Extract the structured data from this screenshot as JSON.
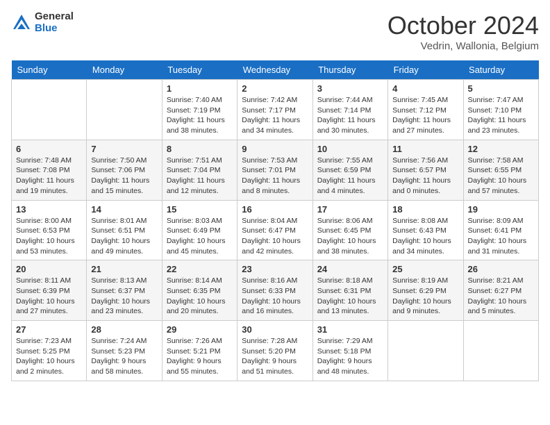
{
  "logo": {
    "general": "General",
    "blue": "Blue"
  },
  "title": "October 2024",
  "location": "Vedrin, Wallonia, Belgium",
  "days_of_week": [
    "Sunday",
    "Monday",
    "Tuesday",
    "Wednesday",
    "Thursday",
    "Friday",
    "Saturday"
  ],
  "weeks": [
    [
      {
        "day": "",
        "info": ""
      },
      {
        "day": "",
        "info": ""
      },
      {
        "day": "1",
        "info": "Sunrise: 7:40 AM\nSunset: 7:19 PM\nDaylight: 11 hours and 38 minutes."
      },
      {
        "day": "2",
        "info": "Sunrise: 7:42 AM\nSunset: 7:17 PM\nDaylight: 11 hours and 34 minutes."
      },
      {
        "day": "3",
        "info": "Sunrise: 7:44 AM\nSunset: 7:14 PM\nDaylight: 11 hours and 30 minutes."
      },
      {
        "day": "4",
        "info": "Sunrise: 7:45 AM\nSunset: 7:12 PM\nDaylight: 11 hours and 27 minutes."
      },
      {
        "day": "5",
        "info": "Sunrise: 7:47 AM\nSunset: 7:10 PM\nDaylight: 11 hours and 23 minutes."
      }
    ],
    [
      {
        "day": "6",
        "info": "Sunrise: 7:48 AM\nSunset: 7:08 PM\nDaylight: 11 hours and 19 minutes."
      },
      {
        "day": "7",
        "info": "Sunrise: 7:50 AM\nSunset: 7:06 PM\nDaylight: 11 hours and 15 minutes."
      },
      {
        "day": "8",
        "info": "Sunrise: 7:51 AM\nSunset: 7:04 PM\nDaylight: 11 hours and 12 minutes."
      },
      {
        "day": "9",
        "info": "Sunrise: 7:53 AM\nSunset: 7:01 PM\nDaylight: 11 hours and 8 minutes."
      },
      {
        "day": "10",
        "info": "Sunrise: 7:55 AM\nSunset: 6:59 PM\nDaylight: 11 hours and 4 minutes."
      },
      {
        "day": "11",
        "info": "Sunrise: 7:56 AM\nSunset: 6:57 PM\nDaylight: 11 hours and 0 minutes."
      },
      {
        "day": "12",
        "info": "Sunrise: 7:58 AM\nSunset: 6:55 PM\nDaylight: 10 hours and 57 minutes."
      }
    ],
    [
      {
        "day": "13",
        "info": "Sunrise: 8:00 AM\nSunset: 6:53 PM\nDaylight: 10 hours and 53 minutes."
      },
      {
        "day": "14",
        "info": "Sunrise: 8:01 AM\nSunset: 6:51 PM\nDaylight: 10 hours and 49 minutes."
      },
      {
        "day": "15",
        "info": "Sunrise: 8:03 AM\nSunset: 6:49 PM\nDaylight: 10 hours and 45 minutes."
      },
      {
        "day": "16",
        "info": "Sunrise: 8:04 AM\nSunset: 6:47 PM\nDaylight: 10 hours and 42 minutes."
      },
      {
        "day": "17",
        "info": "Sunrise: 8:06 AM\nSunset: 6:45 PM\nDaylight: 10 hours and 38 minutes."
      },
      {
        "day": "18",
        "info": "Sunrise: 8:08 AM\nSunset: 6:43 PM\nDaylight: 10 hours and 34 minutes."
      },
      {
        "day": "19",
        "info": "Sunrise: 8:09 AM\nSunset: 6:41 PM\nDaylight: 10 hours and 31 minutes."
      }
    ],
    [
      {
        "day": "20",
        "info": "Sunrise: 8:11 AM\nSunset: 6:39 PM\nDaylight: 10 hours and 27 minutes."
      },
      {
        "day": "21",
        "info": "Sunrise: 8:13 AM\nSunset: 6:37 PM\nDaylight: 10 hours and 23 minutes."
      },
      {
        "day": "22",
        "info": "Sunrise: 8:14 AM\nSunset: 6:35 PM\nDaylight: 10 hours and 20 minutes."
      },
      {
        "day": "23",
        "info": "Sunrise: 8:16 AM\nSunset: 6:33 PM\nDaylight: 10 hours and 16 minutes."
      },
      {
        "day": "24",
        "info": "Sunrise: 8:18 AM\nSunset: 6:31 PM\nDaylight: 10 hours and 13 minutes."
      },
      {
        "day": "25",
        "info": "Sunrise: 8:19 AM\nSunset: 6:29 PM\nDaylight: 10 hours and 9 minutes."
      },
      {
        "day": "26",
        "info": "Sunrise: 8:21 AM\nSunset: 6:27 PM\nDaylight: 10 hours and 5 minutes."
      }
    ],
    [
      {
        "day": "27",
        "info": "Sunrise: 7:23 AM\nSunset: 5:25 PM\nDaylight: 10 hours and 2 minutes."
      },
      {
        "day": "28",
        "info": "Sunrise: 7:24 AM\nSunset: 5:23 PM\nDaylight: 9 hours and 58 minutes."
      },
      {
        "day": "29",
        "info": "Sunrise: 7:26 AM\nSunset: 5:21 PM\nDaylight: 9 hours and 55 minutes."
      },
      {
        "day": "30",
        "info": "Sunrise: 7:28 AM\nSunset: 5:20 PM\nDaylight: 9 hours and 51 minutes."
      },
      {
        "day": "31",
        "info": "Sunrise: 7:29 AM\nSunset: 5:18 PM\nDaylight: 9 hours and 48 minutes."
      },
      {
        "day": "",
        "info": ""
      },
      {
        "day": "",
        "info": ""
      }
    ]
  ]
}
